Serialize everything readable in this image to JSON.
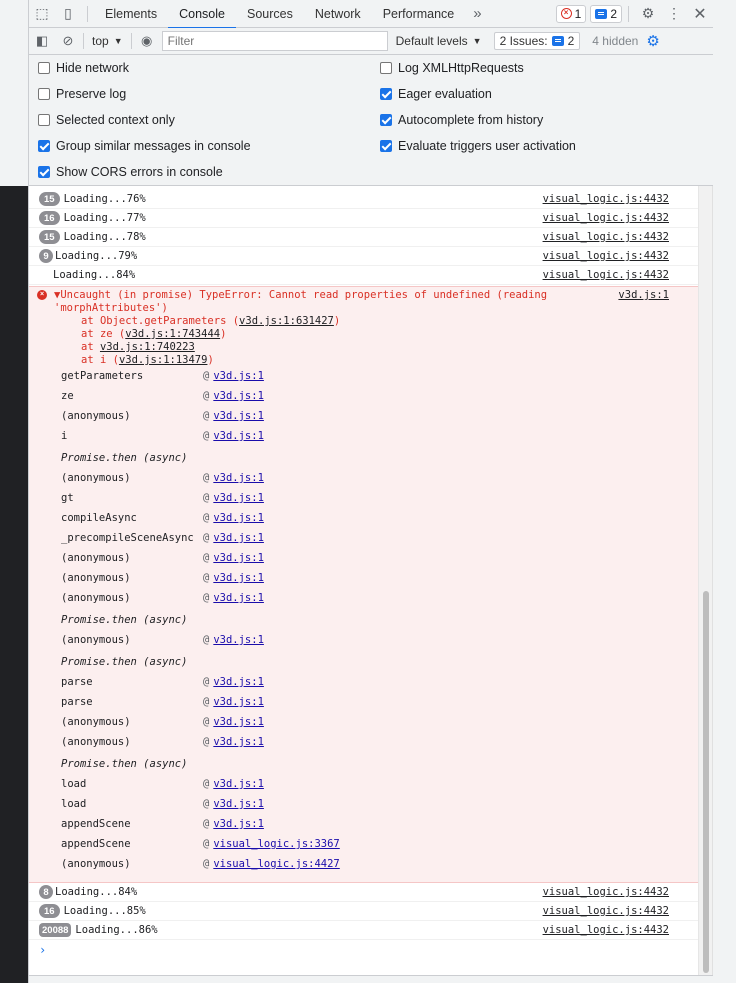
{
  "tabs": [
    "Elements",
    "Console",
    "Sources",
    "Network",
    "Performance"
  ],
  "active_tab": "Console",
  "more_tabs": "»",
  "error_count": "1",
  "message_count": "2",
  "toolbar": {
    "context": "top",
    "filter_placeholder": "Filter",
    "levels": "Default levels",
    "issues_label": "2 Issues:",
    "issues_count": "2",
    "hidden": "4 hidden"
  },
  "settings": {
    "left": [
      {
        "label": "Hide network",
        "checked": false
      },
      {
        "label": "Preserve log",
        "checked": false
      },
      {
        "label": "Selected context only",
        "checked": false
      },
      {
        "label": "Group similar messages in console",
        "checked": true
      },
      {
        "label": "Show CORS errors in console",
        "checked": true
      }
    ],
    "right": [
      {
        "label": "Log XMLHttpRequests",
        "checked": false
      },
      {
        "label": "Eager evaluation",
        "checked": true
      },
      {
        "label": "Autocomplete from history",
        "checked": true
      },
      {
        "label": "Evaluate triggers user activation",
        "checked": true
      }
    ]
  },
  "log_top": [
    {
      "count": "15",
      "text": "Loading...76%",
      "src": "visual_logic.js:4432"
    },
    {
      "count": "16",
      "text": "Loading...77%",
      "src": "visual_logic.js:4432"
    },
    {
      "count": "15",
      "text": "Loading...78%",
      "src": "visual_logic.js:4432"
    },
    {
      "count": "9",
      "text": "Loading...79%",
      "src": "visual_logic.js:4432"
    },
    {
      "count": "",
      "text": "Loading...84%",
      "src": "visual_logic.js:4432"
    }
  ],
  "error": {
    "line1": "▼Uncaught (in promise) TypeError: Cannot read properties of undefined (reading",
    "line2": "'morphAttributes')",
    "src": "v3d.js:1",
    "stack": [
      {
        "prefix": "at Object.getParameters (",
        "link": "v3d.js:1:631427",
        "suffix": ")"
      },
      {
        "prefix": "at ze (",
        "link": "v3d.js:1:743444",
        "suffix": ")"
      },
      {
        "prefix": "at ",
        "link": "v3d.js:1:740223",
        "suffix": ""
      },
      {
        "prefix": "at i (",
        "link": "v3d.js:1:13479",
        "suffix": ")"
      }
    ],
    "frames": [
      {
        "fn": "getParameters",
        "loc": "v3d.js:1"
      },
      {
        "fn": "ze",
        "loc": "v3d.js:1"
      },
      {
        "fn": "(anonymous)",
        "loc": "v3d.js:1"
      },
      {
        "fn": "i",
        "loc": "v3d.js:1"
      },
      {
        "async": "Promise.then (async)"
      },
      {
        "fn": "(anonymous)",
        "loc": "v3d.js:1"
      },
      {
        "fn": "gt",
        "loc": "v3d.js:1"
      },
      {
        "fn": "compileAsync",
        "loc": "v3d.js:1"
      },
      {
        "fn": "_precompileSceneAsync",
        "loc": "v3d.js:1"
      },
      {
        "fn": "(anonymous)",
        "loc": "v3d.js:1"
      },
      {
        "fn": "(anonymous)",
        "loc": "v3d.js:1"
      },
      {
        "fn": "(anonymous)",
        "loc": "v3d.js:1"
      },
      {
        "async": "Promise.then (async)"
      },
      {
        "fn": "(anonymous)",
        "loc": "v3d.js:1"
      },
      {
        "async": "Promise.then (async)"
      },
      {
        "fn": "parse",
        "loc": "v3d.js:1"
      },
      {
        "fn": "parse",
        "loc": "v3d.js:1"
      },
      {
        "fn": "(anonymous)",
        "loc": "v3d.js:1"
      },
      {
        "fn": "(anonymous)",
        "loc": "v3d.js:1"
      },
      {
        "async": "Promise.then (async)"
      },
      {
        "fn": "load",
        "loc": "v3d.js:1"
      },
      {
        "fn": "load",
        "loc": "v3d.js:1"
      },
      {
        "fn": "appendScene",
        "loc": "v3d.js:1"
      },
      {
        "fn": "appendScene",
        "loc": "visual_logic.js:3367"
      },
      {
        "fn": "(anonymous)",
        "loc": "visual_logic.js:4427"
      }
    ]
  },
  "log_bottom": [
    {
      "count": "8",
      "text": "Loading...84%",
      "src": "visual_logic.js:4432"
    },
    {
      "count": "16",
      "text": "Loading...85%",
      "src": "visual_logic.js:4432"
    },
    {
      "count": "20088",
      "text": "Loading...86%",
      "src": "visual_logic.js:4432"
    }
  ],
  "prompt": "›"
}
